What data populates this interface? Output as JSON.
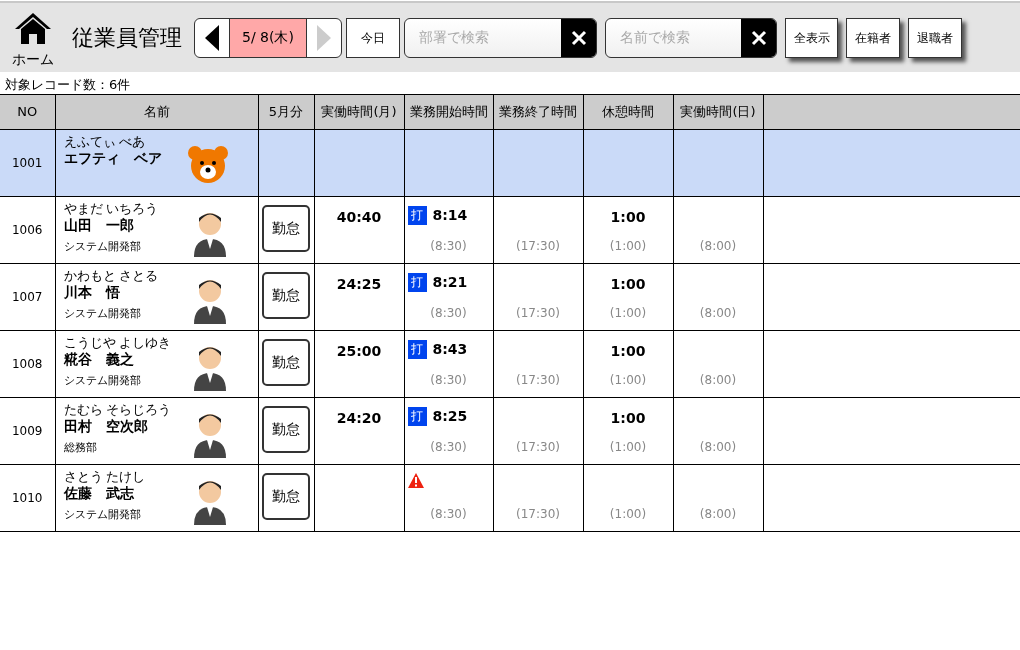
{
  "header": {
    "home_label": "ホーム",
    "title": "従業員管理",
    "date_nav": {
      "prev_disabled": false,
      "date": "5/ 8(木)",
      "next_disabled": true
    },
    "today_button": "今日",
    "dept_search": {
      "placeholder": "部署で検索"
    },
    "name_search": {
      "placeholder": "名前で検索"
    },
    "filter_buttons": [
      "全表示",
      "在籍者",
      "退職者"
    ]
  },
  "record_count": "対象レコード数：6件",
  "table": {
    "columns": [
      "NO",
      "名前",
      "5月分",
      "実働時間(月)",
      "業務開始時間",
      "業務終了時間",
      "休憩時間",
      "実働時間(日)"
    ],
    "rows": [
      {
        "no": "1001",
        "kana": "えふてぃ べあ",
        "name": "エフティ　ベア",
        "kind": "mascot",
        "selected": true
      },
      {
        "no": "1006",
        "kana": "やまだ いちろう",
        "name": "山田　一郎",
        "dept": "システム開発部",
        "kind": "person",
        "selected": false,
        "attendance_button": "勤怠",
        "monthly": "40:40",
        "start_mark": {
          "kind": "punch",
          "label": "打"
        },
        "start": "8:14",
        "start_planned": "(8:30)",
        "end_planned": "(17:30)",
        "break": "1:00",
        "break_planned": "(1:00)",
        "daily_planned": "(8:00)"
      },
      {
        "no": "1007",
        "kana": "かわもと さとる",
        "name": "川本　悟",
        "dept": "システム開発部",
        "kind": "person",
        "selected": false,
        "attendance_button": "勤怠",
        "monthly": "24:25",
        "start_mark": {
          "kind": "punch",
          "label": "打"
        },
        "start": "8:21",
        "start_planned": "(8:30)",
        "end_planned": "(17:30)",
        "break": "1:00",
        "break_planned": "(1:00)",
        "daily_planned": "(8:00)"
      },
      {
        "no": "1008",
        "kana": "こうじや よしゆき",
        "name": "糀谷　義之",
        "dept": "システム開発部",
        "kind": "person",
        "selected": false,
        "attendance_button": "勤怠",
        "monthly": "25:00",
        "start_mark": {
          "kind": "punch",
          "label": "打"
        },
        "start": "8:43",
        "start_planned": "(8:30)",
        "end_planned": "(17:30)",
        "break": "1:00",
        "break_planned": "(1:00)",
        "daily_planned": "(8:00)"
      },
      {
        "no": "1009",
        "kana": "たむら そらじろう",
        "name": "田村　空次郎",
        "dept": "総務部",
        "kind": "person",
        "selected": false,
        "attendance_button": "勤怠",
        "monthly": "24:20",
        "start_mark": {
          "kind": "punch",
          "label": "打"
        },
        "start": "8:25",
        "start_planned": "(8:30)",
        "end_planned": "(17:30)",
        "break": "1:00",
        "break_planned": "(1:00)",
        "daily_planned": "(8:00)"
      },
      {
        "no": "1010",
        "kana": "さとう たけし",
        "name": "佐藤　武志",
        "dept": "システム開発部",
        "kind": "person",
        "selected": false,
        "attendance_button": "勤怠",
        "start_mark": {
          "kind": "warning"
        },
        "start_planned": "(8:30)",
        "end_planned": "(17:30)",
        "break_planned": "(1:00)",
        "daily_planned": "(8:00)"
      }
    ]
  }
}
